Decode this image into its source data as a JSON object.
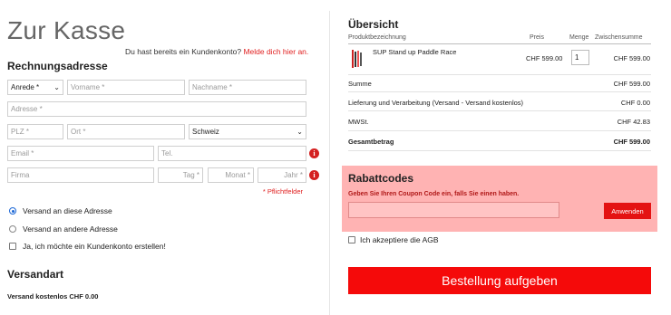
{
  "checkout": {
    "title": "Zur Kasse",
    "login_hint_text": "Du hast bereits ein Kundenkonto?",
    "login_link": "Melde dich hier an."
  },
  "billing": {
    "title": "Rechnungsadresse",
    "salutation_value": "Anrede *",
    "firstname_placeholder": "Vorname *",
    "lastname_placeholder": "Nachname *",
    "address_placeholder": "Adresse *",
    "zip_placeholder": "PLZ *",
    "city_placeholder": "Ort *",
    "country_value": "Schweiz",
    "email_placeholder": "Email *",
    "phone_placeholder": "Tel.",
    "company_placeholder": "Firma",
    "day_placeholder": "Tag *",
    "month_placeholder": "Monat *",
    "year_placeholder": "Jahr *",
    "required_note": "* Pflichtfelder"
  },
  "options": {
    "ship_same": "Versand an diese Adresse",
    "ship_other": "Versand an andere Adresse",
    "create_account": "Ja, ich möchte ein Kundenkonto erstellen!"
  },
  "shipping": {
    "title": "Versandart",
    "text": "Versand kostenlos CHF 0.00"
  },
  "overview": {
    "title": "Übersicht",
    "headers": {
      "product": "Produktbezeichnung",
      "price": "Preis",
      "qty": "Menge",
      "subtotal": "Zwischensumme"
    },
    "item": {
      "name": "SUP Stand up Paddle Race",
      "price": "CHF 599.00",
      "qty": "1",
      "subtotal": "CHF 599.00"
    },
    "summary": [
      {
        "label": "Summe",
        "value": "CHF 599.00"
      },
      {
        "label": "Lieferung und Verarbeitung (Versand - Versand kostenlos)",
        "value": "CHF 0.00"
      },
      {
        "label": "MWSt.",
        "value": "CHF 42.83"
      },
      {
        "label": "Gesamtbetrag",
        "value": "CHF 599.00"
      }
    ]
  },
  "coupon": {
    "title": "Rabattcodes",
    "description": "Geben Sie Ihren Coupon Code ein, falls Sie einen haben.",
    "apply_label": "Anwenden"
  },
  "agb": {
    "text_prefix": "Ich akzeptiere die ",
    "link": "AGB"
  },
  "order_button": "Bestellung aufgeben",
  "colors": {
    "accent_red": "#f50a0a",
    "coupon_bg": "#ffb3b3",
    "link_red": "#e02020"
  }
}
